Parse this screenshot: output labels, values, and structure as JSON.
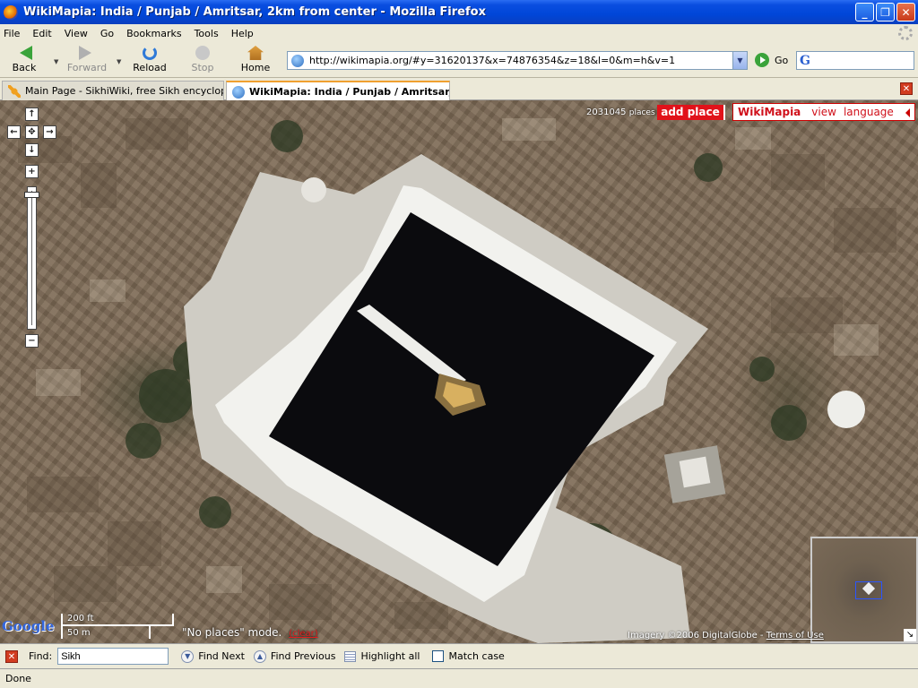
{
  "window": {
    "title": "WikiMapia: India / Punjab / Amritsar, 2km from center - Mozilla Firefox"
  },
  "menu": [
    "File",
    "Edit",
    "View",
    "Go",
    "Bookmarks",
    "Tools",
    "Help"
  ],
  "nav": {
    "back": "Back",
    "forward": "Forward",
    "reload": "Reload",
    "stop": "Stop",
    "home": "Home",
    "go": "Go"
  },
  "url": "http://wikimapia.org/#y=31620137&x=74876354&z=18&l=0&m=h&v=1",
  "search": {
    "engine_icon": "google-icon",
    "value": ""
  },
  "tabs": [
    {
      "label": "Main Page - SikhiWiki, free Sikh encyclopedia.",
      "active": false
    },
    {
      "label": "WikiMapia: India / Punjab / Amritsar,...",
      "active": true
    }
  ],
  "map": {
    "places_count": "2031045",
    "places_label": "places",
    "add_place": "add place",
    "brand": "WikiMapia",
    "view": "view",
    "language": "language",
    "scale_ft": "200 ft",
    "scale_m": "50 m",
    "mode_text": "\"No places\" mode.",
    "mode_link": "(clear)",
    "google_logo": "Google",
    "copyright": "Imagery ©2006 DigitalGlobe -",
    "terms": "Terms of Use"
  },
  "find": {
    "label": "Find:",
    "value": "Sikh",
    "next": "Find Next",
    "previous": "Find Previous",
    "highlight": "Highlight all",
    "match_case": "Match case"
  },
  "status": "Done",
  "colors": {
    "titlebar": "#0046d8",
    "wikimapia_red": "#e1121a",
    "water": "#0b0b0e"
  }
}
